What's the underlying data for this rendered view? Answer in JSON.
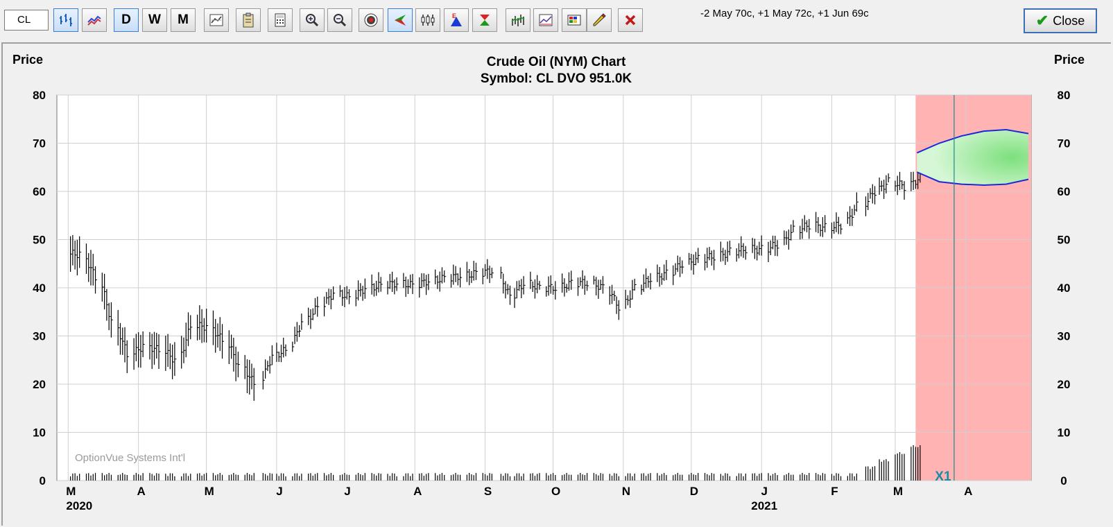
{
  "toolbar": {
    "symbol_value": "CL",
    "period_buttons": [
      "D",
      "W",
      "M"
    ],
    "strategy_text": "-2 May 70c, +1 May 72c, +1 Jun 69c",
    "close_label": "Close",
    "icons": [
      "bar-chart-icon",
      "line-chart-icon",
      "day-button",
      "week-button",
      "month-button",
      "chart-settings-icon",
      "clipboard-icon",
      "calculator-icon",
      "zoom-in-icon",
      "zoom-out-icon",
      "target-icon",
      "arrow-left-icon",
      "ohlc-icon",
      "earnings-icon",
      "dividend-icon",
      "volume-icon",
      "study-icon",
      "palette-icon",
      "pencil-icon",
      "delete-icon"
    ]
  },
  "chart": {
    "title": "Crude Oil (NYM) Chart",
    "subtitle": "Symbol: CL  DVO 951.0K",
    "y_label_left": "Price",
    "y_label_right": "Price",
    "watermark": "OptionVue Systems Int'l",
    "marker_label": "X1",
    "month_labels": [
      "M",
      "A",
      "M",
      "J",
      "J",
      "A",
      "S",
      "O",
      "N",
      "D",
      "J",
      "F",
      "M",
      "A"
    ],
    "year_labels": [
      "2020",
      "2021"
    ],
    "y_ticks": [
      "80",
      "70",
      "60",
      "50",
      "40",
      "30",
      "20",
      "10",
      "0"
    ]
  },
  "chart_data": {
    "type": "bar",
    "title": "Crude Oil (NYM) Chart",
    "subtitle": "Symbol: CL  DVO 951.0K",
    "ylabel": "Price",
    "ylim": [
      0,
      80
    ],
    "yticks": [
      0,
      10,
      20,
      30,
      40,
      50,
      60,
      70,
      80
    ],
    "x_months": [
      "M",
      "A",
      "M",
      "J",
      "J",
      "A",
      "S",
      "O",
      "N",
      "D",
      "J",
      "F",
      "M",
      "A"
    ],
    "x_years": [
      "2020",
      "2021"
    ],
    "series": [
      {
        "name": "",
        "x": [
          "2020-03-02",
          "2020-03-09",
          "2020-03-16",
          "2020-03-23",
          "2020-03-30",
          "2020-04-06",
          "2020-04-13",
          "2020-04-20",
          "2020-04-27",
          "2020-05-04",
          "2020-05-11",
          "2020-05-18",
          "2020-05-26",
          "2020-06-01",
          "2020-06-08",
          "2020-06-15",
          "2020-06-22",
          "2020-06-29",
          "2020-07-06",
          "2020-07-13",
          "2020-07-20",
          "2020-07-27",
          "2020-08-03",
          "2020-08-10",
          "2020-08-17",
          "2020-08-24",
          "2020-08-31",
          "2020-09-08",
          "2020-09-14",
          "2020-09-21",
          "2020-09-28",
          "2020-10-05",
          "2020-10-12",
          "2020-10-19",
          "2020-10-26",
          "2020-11-02",
          "2020-11-09",
          "2020-11-16",
          "2020-11-23",
          "2020-11-30",
          "2020-12-07",
          "2020-12-14",
          "2020-12-21",
          "2020-12-28",
          "2021-01-04",
          "2021-01-11",
          "2021-01-18",
          "2021-01-25",
          "2021-02-01",
          "2021-02-08",
          "2021-02-16",
          "2021-02-22",
          "2021-03-01",
          "2021-03-08"
        ],
        "values": [
          47,
          42,
          33,
          26,
          28,
          27,
          25,
          32,
          32,
          29,
          24,
          20,
          26,
          27,
          33,
          36,
          39,
          38,
          40,
          40.5,
          41,
          40.5,
          41.5,
          42,
          42.5,
          43,
          43.5,
          38,
          41,
          40,
          40,
          41,
          41,
          40,
          36,
          40,
          42,
          43,
          45,
          46,
          46.5,
          47.5,
          48,
          48,
          49,
          52,
          53,
          52.5,
          53,
          57,
          60,
          62,
          61,
          63
        ]
      }
    ],
    "annotations": {
      "projection_upper": [
        68,
        70,
        71.5,
        72.5,
        72.8,
        72
      ],
      "projection_lower": [
        64,
        62,
        61.5,
        61.3,
        61.5,
        62.5
      ]
    }
  }
}
